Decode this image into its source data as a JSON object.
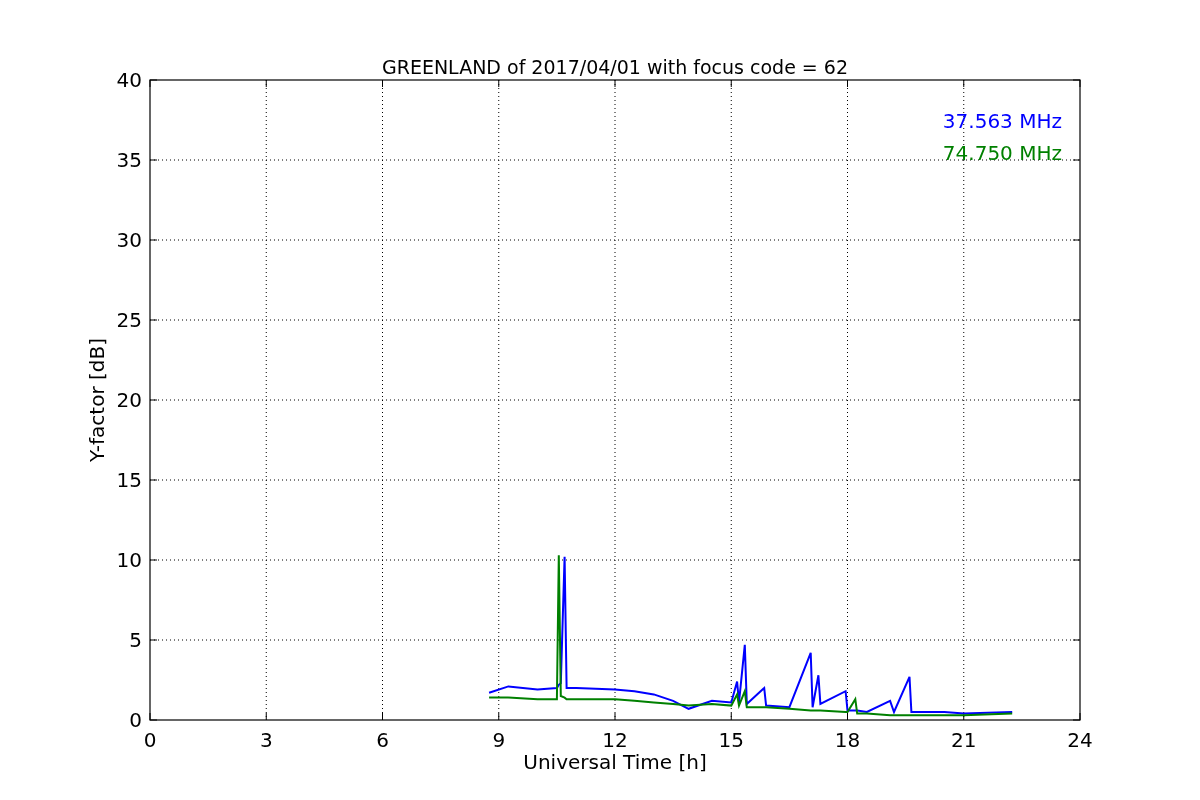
{
  "chart_data": {
    "type": "line",
    "title": "GREENLAND of 2017/04/01 with focus code = 62",
    "xlabel": "Universal Time [h]",
    "ylabel": "Y-factor [dB]",
    "x": [
      8.75,
      9.25,
      10.0,
      10.5,
      10.55,
      10.6,
      10.7,
      10.75,
      11.0,
      12.0,
      12.5,
      13.0,
      13.5,
      13.9,
      14.5,
      15.0,
      15.15,
      15.2,
      15.35,
      15.4,
      15.85,
      15.9,
      16.5,
      17.05,
      17.1,
      17.25,
      17.3,
      17.95,
      18.0,
      18.2,
      18.25,
      18.5,
      19.1,
      19.2,
      19.6,
      19.65,
      20.5,
      21.0,
      22.25
    ],
    "series": [
      {
        "name": "37.563 MHz",
        "color": "#0000ff",
        "values": [
          1.7,
          2.1,
          1.9,
          2.0,
          2.2,
          2.3,
          10.2,
          2.0,
          2.0,
          1.9,
          1.8,
          1.6,
          1.2,
          0.7,
          1.2,
          1.1,
          2.4,
          1.1,
          4.7,
          1.0,
          2.0,
          0.9,
          0.8,
          4.2,
          0.8,
          2.8,
          1.0,
          1.8,
          0.6,
          0.6,
          0.6,
          0.5,
          1.2,
          0.5,
          2.7,
          0.5,
          0.5,
          0.4,
          0.5
        ]
      },
      {
        "name": "74.750 MHz",
        "color": "#008000",
        "values": [
          1.4,
          1.4,
          1.3,
          1.3,
          10.3,
          1.5,
          1.4,
          1.3,
          1.3,
          1.3,
          1.2,
          1.1,
          1.0,
          0.9,
          1.0,
          0.9,
          1.6,
          0.9,
          1.8,
          0.8,
          0.8,
          0.8,
          0.7,
          0.6,
          0.6,
          0.6,
          0.6,
          0.5,
          0.5,
          1.3,
          0.4,
          0.4,
          0.3,
          0.3,
          0.3,
          0.3,
          0.3,
          0.3,
          0.4
        ]
      }
    ],
    "grid": true,
    "xlim": [
      0,
      24
    ],
    "ylim": [
      0,
      40
    ],
    "xticks": [
      0,
      3,
      6,
      9,
      12,
      15,
      18,
      21,
      24
    ],
    "yticks": [
      0,
      5,
      10,
      15,
      20,
      25,
      30,
      35,
      40
    ]
  }
}
